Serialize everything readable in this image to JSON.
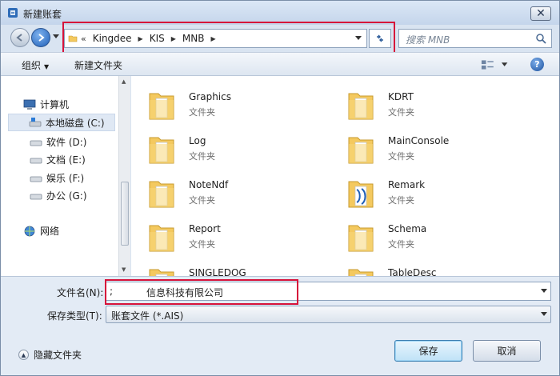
{
  "window": {
    "title": "新建账套"
  },
  "address": {
    "breadcrumb_prefix": "«",
    "crumbs": [
      "Kingdee",
      "KIS",
      "MNB"
    ],
    "search_placeholder": "搜索 MNB"
  },
  "toolbar": {
    "organize_label": "组织",
    "new_folder_label": "新建文件夹"
  },
  "nav": {
    "computer": "计算机",
    "drives": [
      {
        "label": "本地磁盘 (C:)",
        "selected": true
      },
      {
        "label": "软件 (D:)",
        "selected": false
      },
      {
        "label": "文档 (E:)",
        "selected": false
      },
      {
        "label": "娱乐 (F:)",
        "selected": false
      },
      {
        "label": "办公 (G:)",
        "selected": false
      }
    ],
    "network": "网络"
  },
  "files": [
    {
      "name": "Graphics",
      "type": "文件夹"
    },
    {
      "name": "KDRT",
      "type": "文件夹"
    },
    {
      "name": "Log",
      "type": "文件夹"
    },
    {
      "name": "MainConsole",
      "type": "文件夹"
    },
    {
      "name": "NoteNdf",
      "type": "文件夹"
    },
    {
      "name": "Remark",
      "type": "文件夹"
    },
    {
      "name": "Report",
      "type": "文件夹"
    },
    {
      "name": "Schema",
      "type": "文件夹"
    },
    {
      "name": "SINGLEDOG",
      "type": ""
    },
    {
      "name": "TableDesc",
      "type": ""
    }
  ],
  "form": {
    "filename_label": "文件名(N):",
    "filename_prefix": ";",
    "filename_value": "信息科技有限公司",
    "filetype_label": "保存类型(T):",
    "filetype_value": "账套文件 (*.AIS)"
  },
  "footer": {
    "hide_folders_label": "隐藏文件夹",
    "save_label": "保存",
    "cancel_label": "取消"
  },
  "colors": {
    "highlight": "#d6123a",
    "folder": "#f4c95f"
  }
}
